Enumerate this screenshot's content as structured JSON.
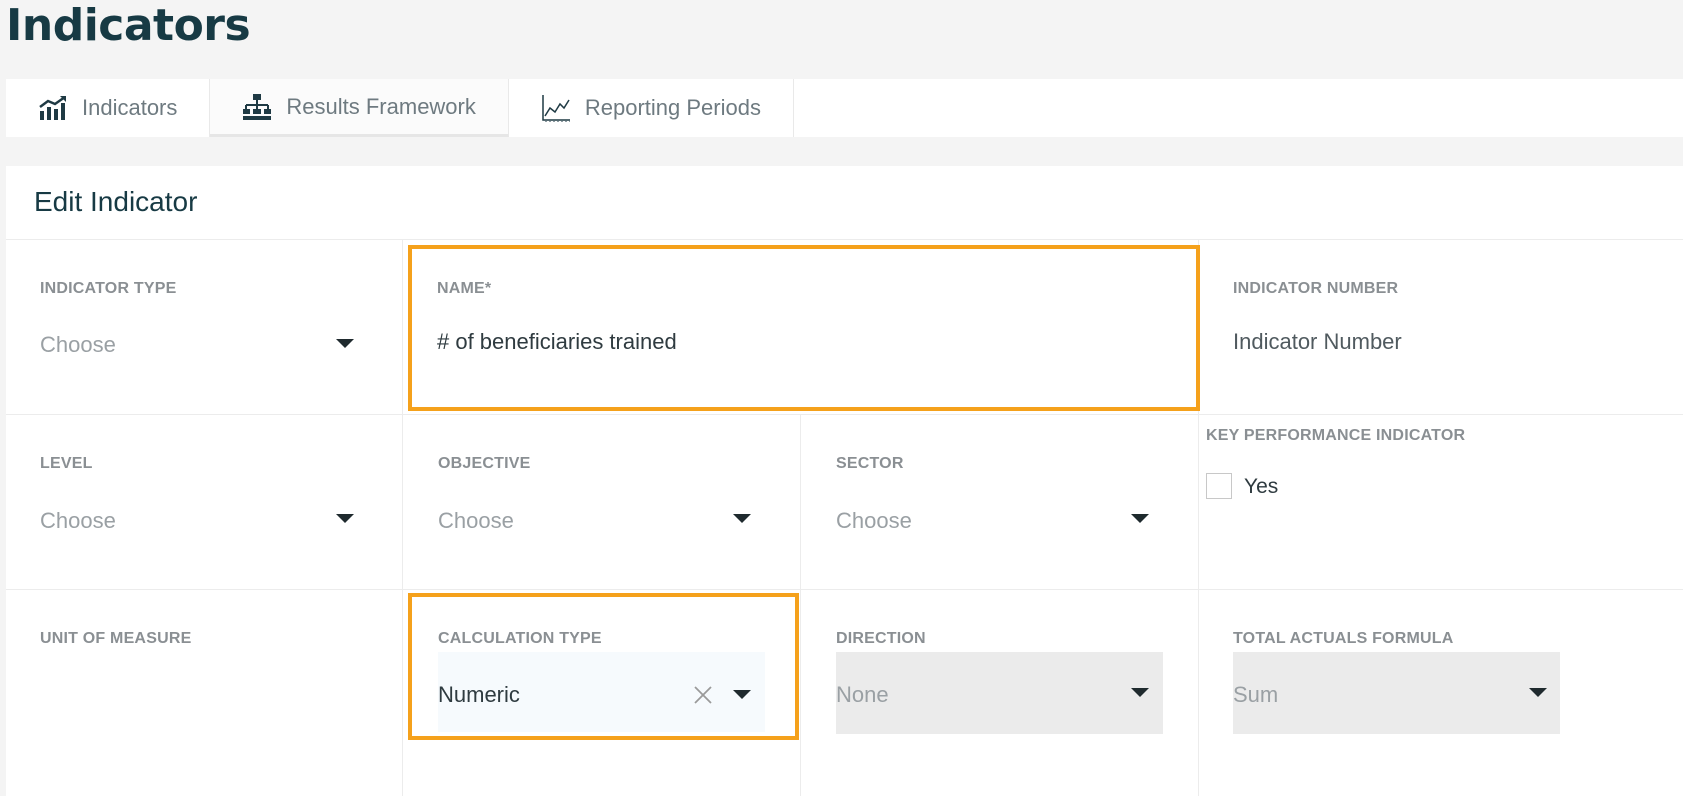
{
  "page": {
    "title": "Indicators"
  },
  "tabs": [
    {
      "label": "Indicators",
      "icon": "chart-up-icon"
    },
    {
      "label": "Results Framework",
      "icon": "hierarchy-icon"
    },
    {
      "label": "Reporting Periods",
      "icon": "line-chart-icon"
    }
  ],
  "form": {
    "title": "Edit Indicator",
    "indicator_type": {
      "label": "INDICATOR TYPE",
      "placeholder": "Choose"
    },
    "name": {
      "label": "NAME*",
      "value": "# of beneficiaries trained"
    },
    "indicator_number": {
      "label": "INDICATOR NUMBER",
      "placeholder": "Indicator Number"
    },
    "level": {
      "label": "LEVEL",
      "placeholder": "Choose"
    },
    "objective": {
      "label": "OBJECTIVE",
      "placeholder": "Choose"
    },
    "sector": {
      "label": "SECTOR",
      "placeholder": "Choose"
    },
    "kpi": {
      "label": "KEY PERFORMANCE INDICATOR",
      "option": "Yes"
    },
    "unit_of_measure": {
      "label": "UNIT OF MEASURE"
    },
    "calculation_type": {
      "label": "CALCULATION TYPE",
      "value": "Numeric"
    },
    "direction": {
      "label": "DIRECTION",
      "value": "None"
    },
    "total_actuals_formula": {
      "label": "TOTAL ACTUALS FORMULA",
      "value": "Sum"
    }
  },
  "colors": {
    "highlight": "#f5a11b",
    "title": "#173a44"
  }
}
